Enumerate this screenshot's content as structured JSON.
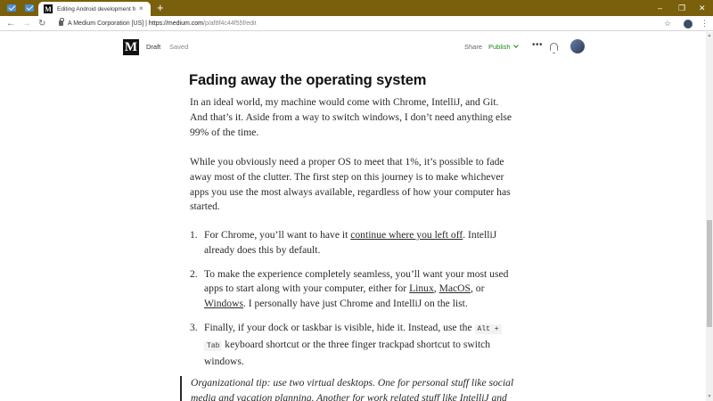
{
  "browser": {
    "tab_title": "Editing Android development fro",
    "tab_close": "×",
    "new_tab": "+",
    "window_controls": [
      "–",
      "❐",
      "✕"
    ],
    "nav": {
      "back": "←",
      "forward": "→",
      "reload": "↻"
    },
    "url_org": "A Medium Corporation [US]",
    "url_sep": " | ",
    "url_host": "https://medium.com",
    "url_path": "/p/af8f4c44f55f/edit",
    "star": "☆",
    "menu": "⋮"
  },
  "header": {
    "logo": "M",
    "status": "Draft",
    "saved": "Saved",
    "share": "Share",
    "publish": "Publish",
    "more": "•••"
  },
  "article": {
    "heading": "Fading away the operating system",
    "p1": "In an ideal world, my machine would come with Chrome, IntelliJ, and Git. And that’s it. Aside from a way to switch windows, I don’t need anything else 99% of the time.",
    "p2": "While you obviously need a proper OS to meet that 1%, it’s possible to fade away most of the clutter. The first step on this journey is to make whichever apps you use the most always available, regardless of how your computer has started.",
    "list": {
      "n1": "1.",
      "i1_a": "For Chrome, you’ll want to have it ",
      "i1_link": "continue where you left off",
      "i1_b": ". IntelliJ already does this by default.",
      "n2": "2.",
      "i2_a": "To make the experience completely seamless, you’ll want your most used apps to start along with your computer, either for ",
      "i2_link1": "Linux",
      "i2_sep1": ", ",
      "i2_link2": "MacOS",
      "i2_sep2": ", or ",
      "i2_link3": "Windows",
      "i2_b": ". I personally have just Chrome and IntelliJ on the list.",
      "n3": "3.",
      "i3_a": "Finally, if your dock or taskbar is visible, hide it. Instead, use the ",
      "i3_code1": "Alt +",
      "i3_code2": "Tab",
      "i3_b": " keyboard shortcut or the three finger trackpad shortcut to switch windows."
    },
    "quote": "Organizational tip: use two virtual desktops. One for personal stuff like social media and vacation planning. Another for work related stuff like IntelliJ and"
  },
  "colors": {
    "tabstrip": "#7a5f0c",
    "publish": "#1a8917",
    "text": "#292929"
  }
}
